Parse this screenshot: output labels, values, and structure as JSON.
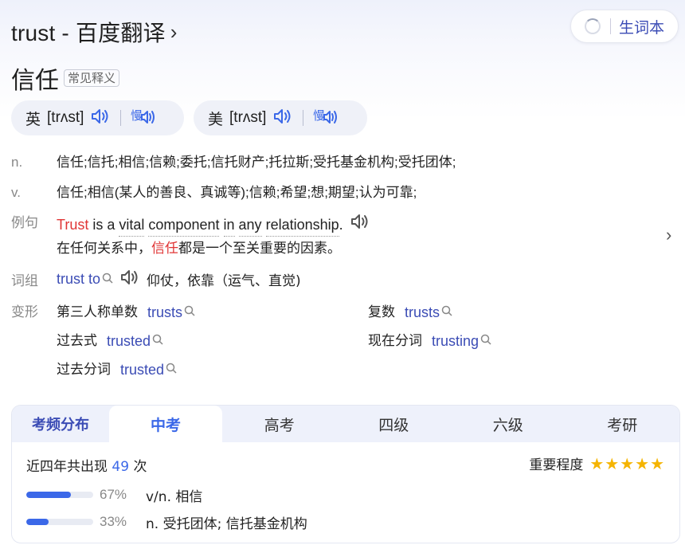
{
  "header": {
    "title": "trust - 百度翻译",
    "chevron": "›",
    "vocab_label": "生词本"
  },
  "word": {
    "headword": "信任",
    "tag": "常见释义"
  },
  "pronunciations": [
    {
      "label": "英",
      "phonetic": "[trʌst]"
    },
    {
      "label": "美",
      "phonetic": "[trʌst]"
    }
  ],
  "definitions": [
    {
      "pos": "n.",
      "text": "信任;信托;相信;信赖;委托;信托财产;托拉斯;受托基金机构;受托团体;"
    },
    {
      "pos": "v.",
      "text": "信任;相信(某人的善良、真诚等);信赖;希望;想;期望;认为可靠;"
    }
  ],
  "example": {
    "label": "例句",
    "en_highlight": "Trust",
    "en_w1": "is a",
    "en_w2": "vital",
    "en_w3": "component",
    "en_w4": "in",
    "en_w5": "any",
    "en_w6": "relationship",
    "en_end": ".",
    "zh_before": "在任何关系中，",
    "zh_highlight": "信任",
    "zh_after": "都是一个至关重要的因素。",
    "more": "›"
  },
  "phrase": {
    "label": "词组",
    "term": "trust to",
    "meaning": "仰仗，依靠（运气、直觉)"
  },
  "forms": {
    "label": "变形",
    "items": [
      {
        "label": "第三人称单数",
        "value": "trusts"
      },
      {
        "label": "复数",
        "value": "trusts"
      },
      {
        "label": "过去式",
        "value": "trusted"
      },
      {
        "label": "现在分词",
        "value": "trusting"
      },
      {
        "label": "过去分词",
        "value": "trusted"
      }
    ]
  },
  "frequency": {
    "tabs": [
      "考频分布",
      "中考",
      "高考",
      "四级",
      "六级",
      "考研"
    ],
    "active_tab": "中考",
    "count_prefix": "近四年共出现",
    "count": "49",
    "count_suffix": "次",
    "importance_label": "重要程度",
    "stars": 5,
    "star_glyphs": "★★★★★",
    "rows": [
      {
        "percent": "67%",
        "value": 0.67,
        "meaning": "v/n. 相信"
      },
      {
        "percent": "33%",
        "value": 0.33,
        "meaning": "n. 受托团体; 信托基金机构"
      }
    ]
  },
  "colors": {
    "accent": "#3b68e8",
    "link": "#3b4cb5",
    "highlight": "#e03535",
    "star": "#f5b400"
  }
}
